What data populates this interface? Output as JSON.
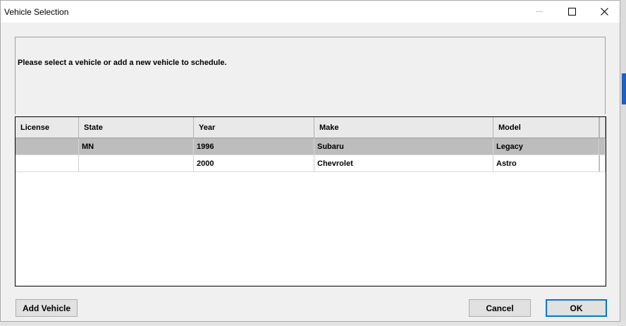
{
  "window": {
    "title": "Vehicle Selection"
  },
  "header": {
    "prompt": "Please select a vehicle or add a new vehicle to schedule."
  },
  "grid": {
    "columns": [
      "License",
      "State",
      "Year",
      "Make",
      "Model"
    ],
    "rows": [
      {
        "license": "",
        "state": "MN",
        "year": "1996",
        "make": "Subaru",
        "model": "Legacy",
        "selected": true
      },
      {
        "license": "",
        "state": "",
        "year": "2000",
        "make": "Chevrolet",
        "model": "Astro",
        "selected": false
      }
    ]
  },
  "buttons": {
    "add_vehicle": "Add Vehicle",
    "cancel": "Cancel",
    "ok": "OK"
  },
  "colors": {
    "selected_row": "#bdbdbd",
    "focus_border": "#0078d7"
  }
}
